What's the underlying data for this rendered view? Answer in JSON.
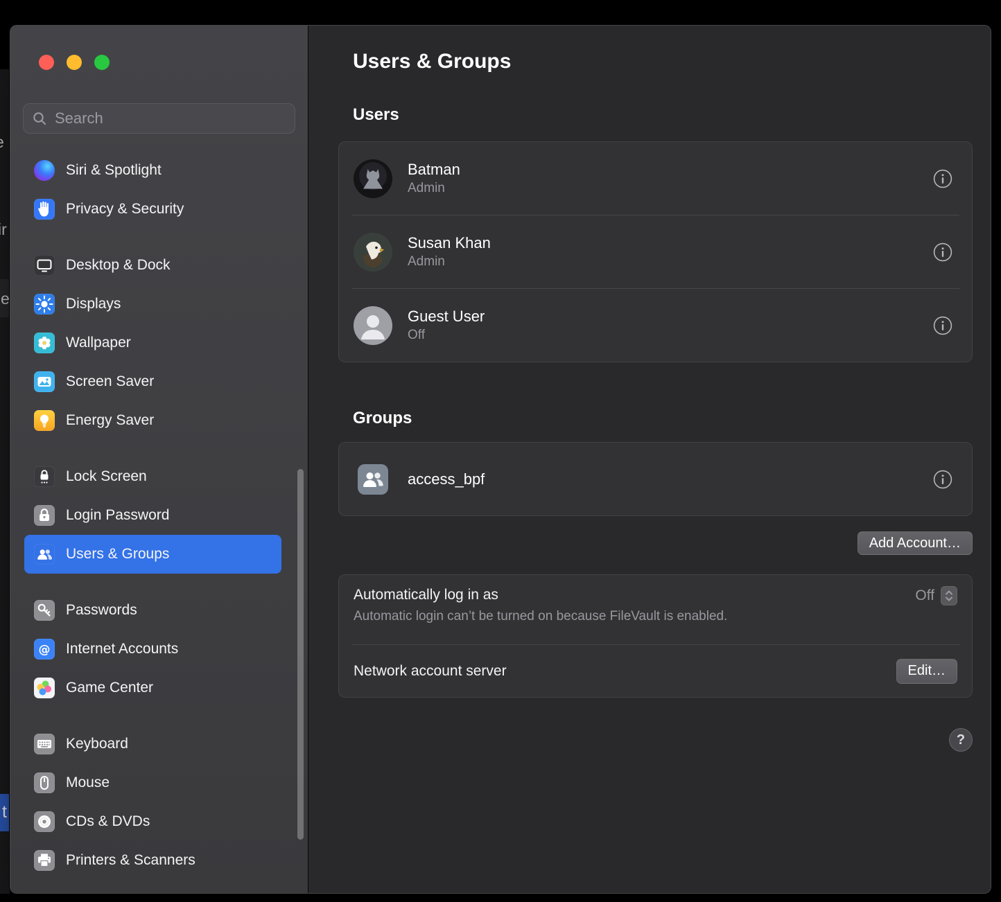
{
  "background": {
    "fragments": [
      {
        "text": "e"
      },
      {
        "text": "ir"
      },
      {
        "text": "e"
      },
      {
        "text": "t"
      }
    ]
  },
  "sidebar": {
    "search": {
      "placeholder": "Search"
    },
    "items": [
      {
        "label": "Siri & Spotlight"
      },
      {
        "label": "Privacy & Security"
      },
      {
        "label": "Desktop & Dock"
      },
      {
        "label": "Displays"
      },
      {
        "label": "Wallpaper"
      },
      {
        "label": "Screen Saver"
      },
      {
        "label": "Energy Saver"
      },
      {
        "label": "Lock Screen"
      },
      {
        "label": "Login Password"
      },
      {
        "label": "Users & Groups",
        "selected": true
      },
      {
        "label": "Passwords"
      },
      {
        "label": "Internet Accounts"
      },
      {
        "label": "Game Center"
      },
      {
        "label": "Keyboard"
      },
      {
        "label": "Mouse"
      },
      {
        "label": "CDs & DVDs"
      },
      {
        "label": "Printers & Scanners"
      }
    ]
  },
  "main": {
    "title": "Users & Groups",
    "users": {
      "header": "Users",
      "rows": [
        {
          "name": "Batman",
          "status": "Admin"
        },
        {
          "name": "Susan Khan",
          "status": "Admin"
        },
        {
          "name": "Guest User",
          "status": "Off"
        }
      ]
    },
    "groups": {
      "header": "Groups",
      "rows": [
        {
          "name": "access_bpf"
        }
      ]
    },
    "add_account_label": "Add Account…",
    "auto_login": {
      "label": "Automatically log in as",
      "value": "Off",
      "note": "Automatic login can’t be turned on because FileVault is enabled."
    },
    "network": {
      "label": "Network account server",
      "edit_label": "Edit…"
    },
    "help_label": "?"
  },
  "colors": {
    "accent": "#3372e7",
    "traffic_red": "#ff5f57",
    "traffic_yellow": "#febc2e",
    "traffic_green": "#28c840",
    "fragment_blue": "#2d5cc0"
  }
}
